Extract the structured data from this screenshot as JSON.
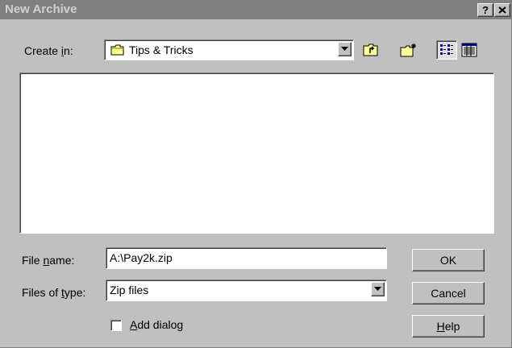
{
  "window": {
    "title": "New Archive",
    "help_label": "?",
    "close_label": "X"
  },
  "create_in": {
    "label": "Create in:",
    "value": "Tips & Tricks",
    "icons": {
      "folder": "folder-icon",
      "dropdown": "dropdown-arrow-icon"
    }
  },
  "toolbar": {
    "up_one_level": "up-one-level-icon",
    "create_new_folder": "new-folder-icon",
    "list_view": "list-view-icon",
    "details_view": "details-view-icon"
  },
  "file_list": {
    "items": []
  },
  "file_name": {
    "label": "File name:",
    "value": "A:\\Pay2k.zip"
  },
  "file_type": {
    "label": "Files of type:",
    "value": "Zip files"
  },
  "add_dialog": {
    "label": "Add dialog",
    "checked": false
  },
  "buttons": {
    "ok": "OK",
    "cancel": "Cancel",
    "help": "Help"
  },
  "colors": {
    "face": "#c0c0c0",
    "titlebar": "#808080",
    "title_text": "#d4d0c8"
  }
}
